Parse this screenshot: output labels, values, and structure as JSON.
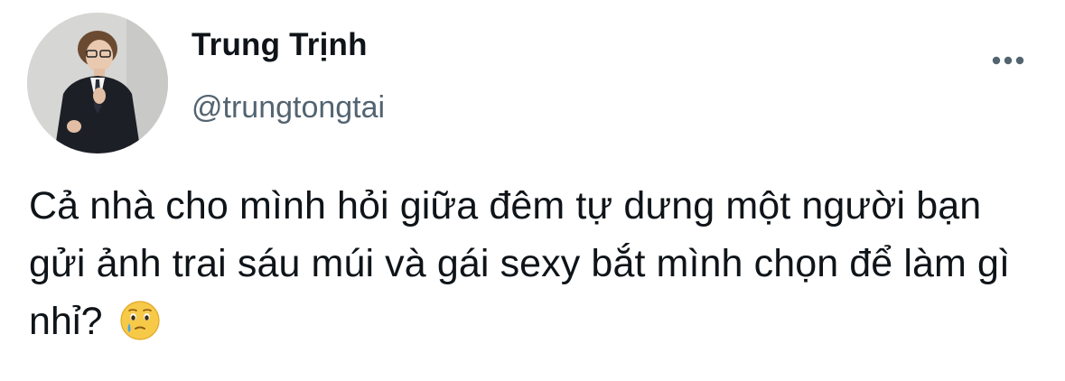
{
  "tweet": {
    "author": {
      "display_name": "Trung Trịnh",
      "handle": "@trungtongtai",
      "avatar_icon": "profile-photo"
    },
    "more_icon": "more-horizontal-icon",
    "text": "Cả nhà cho mình hỏi giữa đêm tự dưng một người bạn gửi ảnh trai sáu múi và gái sexy bắt mình chọn để làm gì nhỉ?",
    "emoji": "face-holding-back-tears-icon",
    "colors": {
      "text_primary": "#0f1419",
      "text_secondary": "#536471"
    }
  }
}
